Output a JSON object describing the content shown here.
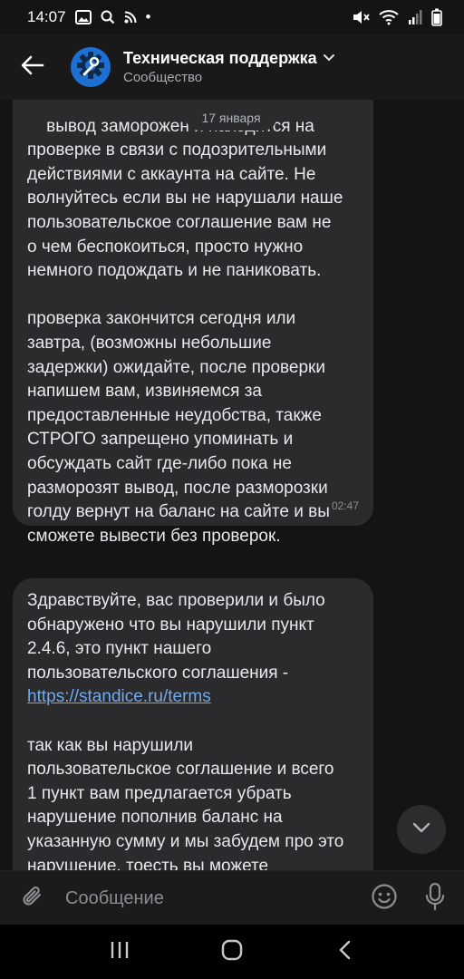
{
  "status_bar": {
    "time": "14:07",
    "dot": "•"
  },
  "header": {
    "title": "Техническая поддержка",
    "subtitle": "Сообщество"
  },
  "date_label": "17 января",
  "messages": [
    {
      "text": "вывод заморожен и находится на\nпроверке в связи с подозрительными\nдействиями с аккаунта на сайте. Не\nволнуйтесь если вы не нарушали наше\nпользовательское соглашение вам не\nо чем беспокоиться, просто нужно\nнемного подождать и не паниковать.\n\nпроверка закончится сегодня или\nзавтра, (возможны небольшие\nзадержки) ожидайте, после проверки\nнапишем вам, извиняемся за\nпредоставленные неудобства, также\nСТРОГО запрещено упоминать и\nобсуждать сайт где-либо пока не\nразморозят вывод, после разморозки\nголду вернут на баланс на сайте и вы\nсможете вывести без проверок.",
      "time": "02:47"
    },
    {
      "text_before": "Здравствуйте, вас проверили и было\nобнаружено что вы нарушили пункт\n2.4.6, это пункт нашего\nпользовательского соглашения -\n",
      "link": "https://standice.ru/terms",
      "text_after": "\n\nтак как вы нарушили\nпользовательское соглашение и всего\n1 пункт вам предлагается убрать\nнарушение пополнив баланс на\nуказанную сумму и мы забудем про это\nнарушение, тоесть вы можете"
    }
  ],
  "composer": {
    "placeholder": "Сообщение"
  },
  "colors": {
    "accent": "#71aaeb",
    "bubble": "#2b2b2d",
    "avatar": "#1d6fd1"
  }
}
